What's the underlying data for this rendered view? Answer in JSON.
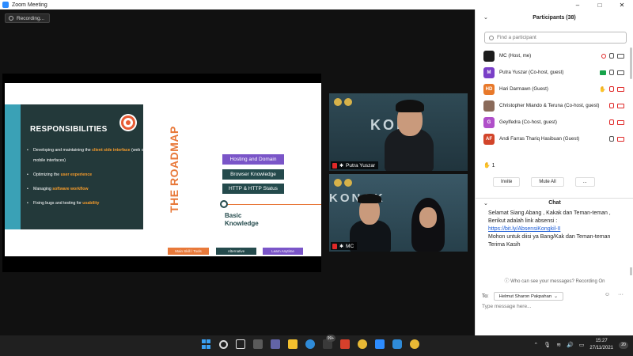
{
  "window": {
    "title": "Zoom Meeting",
    "controls": [
      "–",
      "□",
      "✕"
    ]
  },
  "recording": {
    "label": "Recording..."
  },
  "slide": {
    "card_title": "RESPONSIBILITIES",
    "items": [
      {
        "pre": "Developing and maintaining the ",
        "hl": "client side interface",
        "post": " (web or mobile interfaces)"
      },
      {
        "pre": "Optimizing the ",
        "hl": "user experience",
        "post": ""
      },
      {
        "pre": "Managing ",
        "hl": "software workflow",
        "post": ""
      },
      {
        "pre": "Fixing bugs and testing for ",
        "hl": "usability",
        "post": ""
      }
    ],
    "roadmap_title": "THE ROADMAP",
    "pills": [
      "Hosting and Domain",
      "Browser Knowledge",
      "HTTP & HTTP Status"
    ],
    "milestone": "Basic Knowledge",
    "legend": [
      "Main Skill / Tools",
      "Alternative",
      "Learn Anytime"
    ]
  },
  "videos": [
    {
      "name": "Putra Yuszar",
      "bg_word": "KONG"
    },
    {
      "name": "MC",
      "bg_word": "KONGK"
    }
  ],
  "participants": {
    "header": "Participants (38)",
    "search_placeholder": "Find a participant",
    "list": [
      {
        "initials": "",
        "name": "MC (Host, me)",
        "avatar_color": "#1c1c1c",
        "icons": [
          "rec",
          "mic-on",
          "cam-on"
        ]
      },
      {
        "initials": "M",
        "name": "Putra Yuszar (Co-host, guest)",
        "avatar_color": "#7a3fc7",
        "icons": [
          "share",
          "mic-on",
          "cam-on"
        ]
      },
      {
        "initials": "HD",
        "name": "Hari Darmawn (Guest)",
        "avatar_color": "#e8792a",
        "icons": [
          "hand",
          "mic-off",
          "cam-off"
        ]
      },
      {
        "initials": "",
        "name": "Christopher Miando & Teruna (Co-host, guest)",
        "avatar_color": "#8a6a5a",
        "icons": [
          "mic-off",
          "cam-off"
        ]
      },
      {
        "initials": "G",
        "name": "Geylfedra (Co-host, guest)",
        "avatar_color": "#b04fc9",
        "icons": [
          "mic-off",
          "cam-off"
        ]
      },
      {
        "initials": "AF",
        "name": "Andi Farras Thariq Hasibuan (Guest)",
        "avatar_color": "#d2452a",
        "icons": [
          "mic-on",
          "cam-off"
        ]
      }
    ],
    "raise_count": "1",
    "buttons": [
      "Invite",
      "Mute All",
      "..."
    ]
  },
  "chat": {
    "header": "Chat",
    "message_lines": [
      "Selamat Siang Abang , Kakak dan Teman-teman , Berikut adalah link absensi :"
    ],
    "link": "https://bit.ly/AbsensiKongkil-II",
    "message_tail": "Mohon untuk diisi ya Bang/Kak dan Teman-teman",
    "signoff": "Terima Kasih",
    "who_can_see": "Who can see your messages? Recording On",
    "to_label": "To:",
    "to_value": "Helmut Sharon Pakpahan",
    "compose_placeholder": "Type message here..."
  },
  "taskbar": {
    "time": "15:27",
    "date": "27/11/2021",
    "notifications": "20",
    "badge": "99+"
  },
  "colors": {
    "accent_orange": "#e8793a",
    "purple": "#7a55c8",
    "teal_dark": "#244a4c",
    "zoom_blue": "#2d8cff",
    "mute_red": "#e02828"
  }
}
